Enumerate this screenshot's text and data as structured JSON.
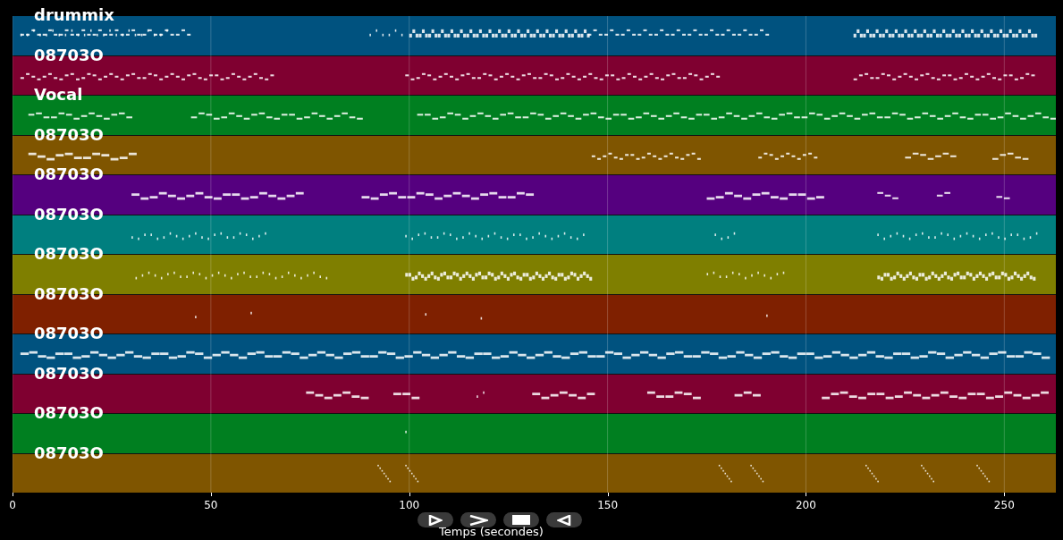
{
  "tracks": [
    {
      "label": "drummix",
      "color": "#00527f"
    },
    {
      "label": "08703O",
      "color": "#7f0030"
    },
    {
      "label": "Vocal",
      "color": "#007f20"
    },
    {
      "label": "08703O",
      "color": "#7f5500"
    },
    {
      "label": "08703O",
      "color": "#55007f"
    },
    {
      "label": "08703O",
      "color": "#007f7f"
    },
    {
      "label": "08703O",
      "color": "#7f7f00"
    },
    {
      "label": "08703O",
      "color": "#7f2000"
    },
    {
      "label": "08703O",
      "color": "#00527f"
    },
    {
      "label": "08703O",
      "color": "#7f0030"
    },
    {
      "label": "08703O",
      "color": "#007f20"
    },
    {
      "label": "08703O",
      "color": "#7f5500"
    }
  ],
  "x_axis": {
    "ticks": [
      "0",
      "50",
      "100",
      "150",
      "200",
      "250"
    ],
    "label": "Temps (secondes)"
  },
  "controls": [
    {
      "kind": "play"
    },
    {
      "kind": "forward"
    },
    {
      "kind": "stop"
    },
    {
      "kind": "back"
    }
  ]
}
